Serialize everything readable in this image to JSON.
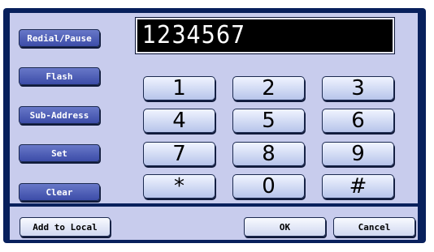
{
  "display": {
    "value": "1234567"
  },
  "side_buttons": {
    "redial_pause": "Redial/Pause",
    "flash": "Flash",
    "sub_address": "Sub-Address",
    "set": "Set",
    "clear": "Clear"
  },
  "keypad": {
    "k1": "1",
    "k2": "2",
    "k3": "3",
    "k4": "4",
    "k5": "5",
    "k6": "6",
    "k7": "7",
    "k8": "8",
    "k9": "9",
    "kstar": "*",
    "k0": "0",
    "khash": "#"
  },
  "bottom": {
    "add_to_local": "Add to Local",
    "ok": "OK",
    "cancel": "Cancel"
  },
  "colors": {
    "frame": "#08205c",
    "panel": "#c8cced",
    "side_button": "#4a5ab8",
    "display_bg": "#000000"
  }
}
